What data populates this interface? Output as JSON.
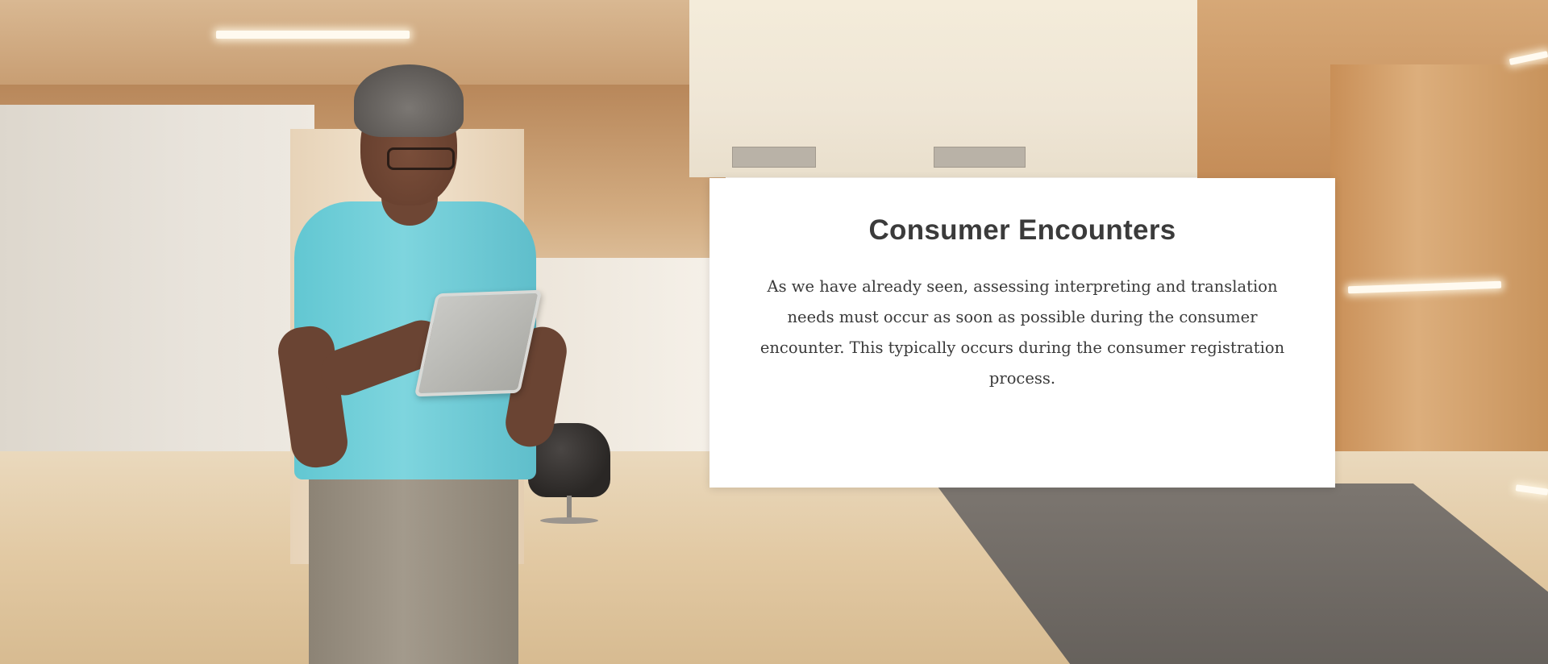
{
  "slide": {
    "title": "Consumer Encounters",
    "body": "As we have already seen, assessing interpreting and translation needs must occur as soon as possible during the consumer encounter. This typically occurs during the consumer registration process.",
    "background": {
      "description_icon": "lobby-photo"
    },
    "colors": {
      "card_background": "#ffffff",
      "title_text": "#3b3b3b",
      "body_text": "#3a3a3a"
    }
  }
}
